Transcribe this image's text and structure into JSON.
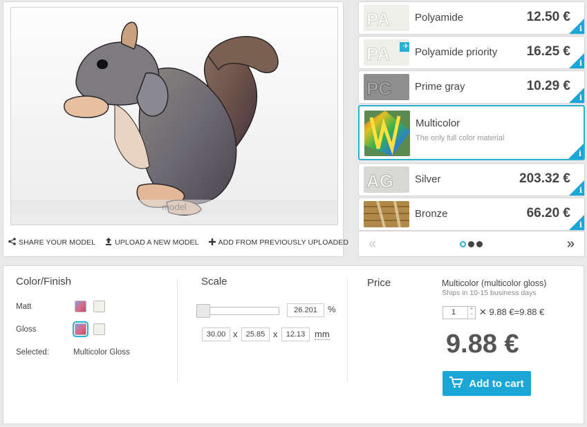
{
  "viewer": {
    "model_label": "model"
  },
  "actions": [
    {
      "icon": "share-icon",
      "label": "SHARE YOUR MODEL"
    },
    {
      "icon": "upload-icon",
      "label": "UPLOAD A NEW MODEL"
    },
    {
      "icon": "plus-icon",
      "label": "ADD FROM PREVIOUSLY UPLOADED"
    }
  ],
  "materials": [
    {
      "name": "Polyamide",
      "price": "12.50 €",
      "thumb_color": "#e8e8e2"
    },
    {
      "name": "Polyamide priority",
      "price": "16.25 €",
      "thumb_color": "#ecece6",
      "badge": "plane-icon"
    },
    {
      "name": "Prime gray",
      "price": "10.29 €",
      "thumb_color": "#9a9a9a"
    },
    {
      "name": "Multicolor",
      "subtitle": "The only full color material",
      "selected": true
    },
    {
      "name": "Silver",
      "price": "203.32 €",
      "thumb_color": "#d8d8d6"
    },
    {
      "name": "Bronze",
      "price": "66.20 €",
      "thumb_color": "#b89050"
    }
  ],
  "pager": {
    "prev": "«",
    "next": "»"
  },
  "color_finish": {
    "title": "Color/Finish",
    "matt_label": "Matt",
    "gloss_label": "Gloss",
    "selected_label": "Selected:",
    "selected_value": "Multicolor Gloss"
  },
  "scale": {
    "title": "Scale",
    "percent": "26.201",
    "percent_unit": "%",
    "x": "30.00",
    "y": "25.85",
    "z": "12.13",
    "times": "x",
    "unit": "mm"
  },
  "price": {
    "title": "Price",
    "product": "Multicolor (multicolor gloss)",
    "ships": "Ships in 10-15 business days",
    "quantity": "1",
    "formula": "✕ 9.88 €=9.88 €",
    "total": "9.88 €",
    "cart_label": "Add to cart"
  },
  "colors": {
    "accent": "#1aa7d8",
    "selected_border": "#2ab0d6"
  }
}
